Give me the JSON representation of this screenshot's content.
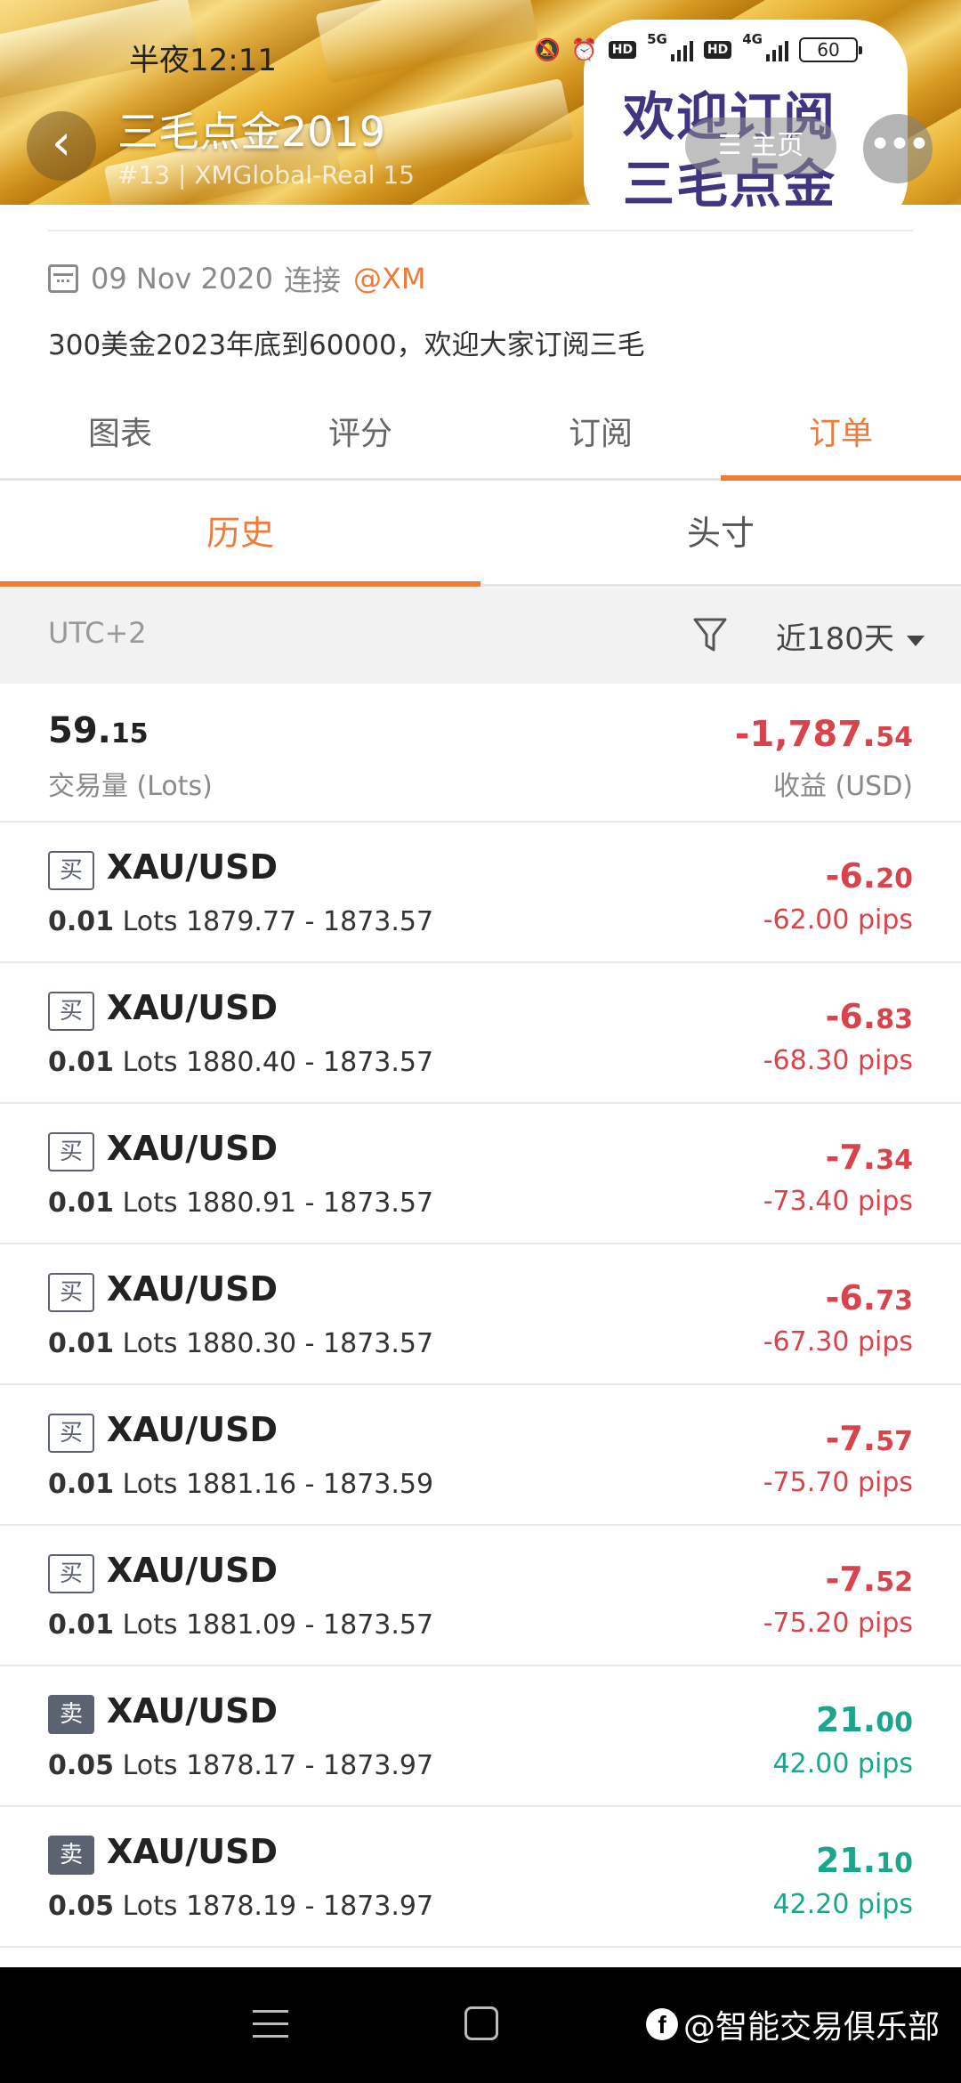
{
  "status_bar": {
    "time": "半夜12:11",
    "network1": "5G",
    "network2": "4G",
    "hd_label": "HD",
    "battery": "60"
  },
  "header": {
    "title": "三毛点金2019",
    "subtitle": "#13 | XMGlobal-Real 15",
    "home_label": "主页",
    "promo_line1": "欢迎订阅",
    "promo_line2": "三毛点金"
  },
  "info": {
    "date": "09 Nov 2020",
    "connect_label": "连接",
    "broker": "@XM",
    "description": "300美金2023年底到60000，欢迎大家订阅三毛"
  },
  "tabs": [
    {
      "label": "图表",
      "active": false
    },
    {
      "label": "评分",
      "active": false
    },
    {
      "label": "订阅",
      "active": false
    },
    {
      "label": "订单",
      "active": true
    }
  ],
  "subtabs": [
    {
      "label": "历史",
      "active": true
    },
    {
      "label": "头寸",
      "active": false
    }
  ],
  "filter": {
    "timezone": "UTC+2",
    "range": "近180天"
  },
  "summary": {
    "volume_int": "59.",
    "volume_dec": "15",
    "volume_label": "交易量 (Lots)",
    "profit_int": "-1,787.",
    "profit_dec": "54",
    "profit_label": "收益 (USD)"
  },
  "orders": [
    {
      "side": "买",
      "symbol": "XAU/USD",
      "lots": "0.01",
      "lots_unit": "Lots",
      "prices": "1879.77 - 1873.57",
      "pnl_int": "-6.",
      "pnl_dec": "20",
      "pips": "-62.00 pips",
      "positive": false
    },
    {
      "side": "买",
      "symbol": "XAU/USD",
      "lots": "0.01",
      "lots_unit": "Lots",
      "prices": "1880.40 - 1873.57",
      "pnl_int": "-6.",
      "pnl_dec": "83",
      "pips": "-68.30 pips",
      "positive": false
    },
    {
      "side": "买",
      "symbol": "XAU/USD",
      "lots": "0.01",
      "lots_unit": "Lots",
      "prices": "1880.91 - 1873.57",
      "pnl_int": "-7.",
      "pnl_dec": "34",
      "pips": "-73.40 pips",
      "positive": false
    },
    {
      "side": "买",
      "symbol": "XAU/USD",
      "lots": "0.01",
      "lots_unit": "Lots",
      "prices": "1880.30 - 1873.57",
      "pnl_int": "-6.",
      "pnl_dec": "73",
      "pips": "-67.30 pips",
      "positive": false
    },
    {
      "side": "买",
      "symbol": "XAU/USD",
      "lots": "0.01",
      "lots_unit": "Lots",
      "prices": "1881.16 - 1873.59",
      "pnl_int": "-7.",
      "pnl_dec": "57",
      "pips": "-75.70 pips",
      "positive": false
    },
    {
      "side": "买",
      "symbol": "XAU/USD",
      "lots": "0.01",
      "lots_unit": "Lots",
      "prices": "1881.09 - 1873.57",
      "pnl_int": "-7.",
      "pnl_dec": "52",
      "pips": "-75.20 pips",
      "positive": false
    },
    {
      "side": "卖",
      "symbol": "XAU/USD",
      "lots": "0.05",
      "lots_unit": "Lots",
      "prices": "1878.17 - 1873.97",
      "pnl_int": "21.",
      "pnl_dec": "00",
      "pips": "42.00 pips",
      "positive": true
    },
    {
      "side": "卖",
      "symbol": "XAU/USD",
      "lots": "0.05",
      "lots_unit": "Lots",
      "prices": "1878.19 - 1873.97",
      "pnl_int": "21.",
      "pnl_dec": "10",
      "pips": "42.20 pips",
      "positive": true
    }
  ],
  "watermark": "@智能交易俱乐部",
  "colors": {
    "accent": "#f07a3a",
    "loss": "#d9434b",
    "gain": "#1aa58c"
  }
}
